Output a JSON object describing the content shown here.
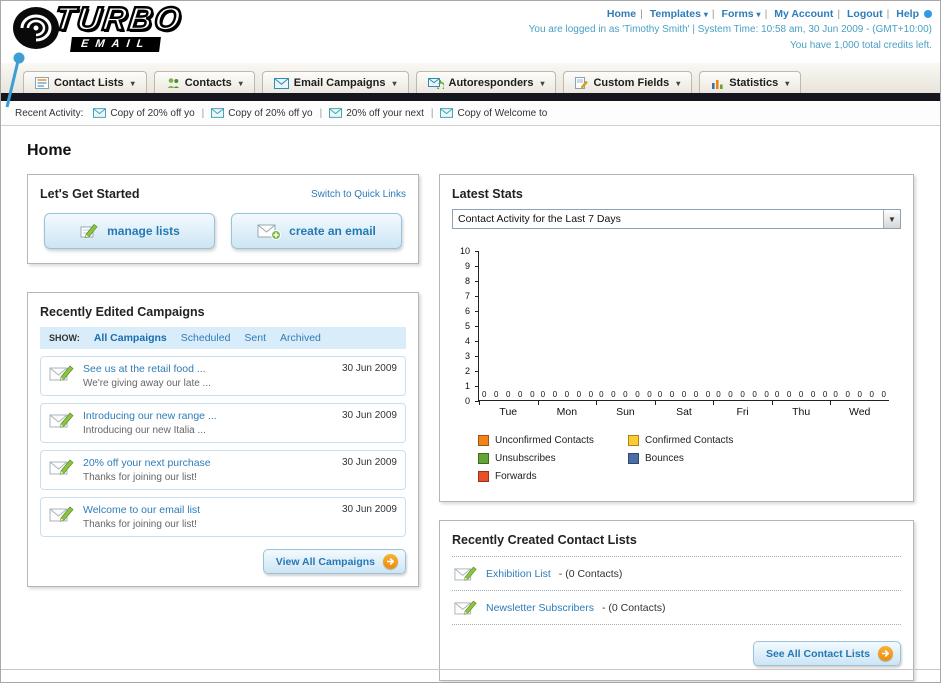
{
  "colors": {
    "link": "#2e7cb8",
    "dark_bar": "#15151d",
    "accent_orange": "#ec8c06"
  },
  "header": {
    "logo_top": "TURBO",
    "logo_bottom": "EMAIL",
    "nav": [
      {
        "label": "Home"
      },
      {
        "label": "Templates"
      },
      {
        "label": "Forms"
      },
      {
        "label": "My Account"
      },
      {
        "label": "Logout"
      },
      {
        "label": "Help"
      }
    ],
    "login_info": "You are logged in as 'Timothy Smith' | System Time: 10:58 am, 30 Jun 2009 - (GMT+10:00)",
    "credits_info": "You have 1,000 total credits left."
  },
  "nav_tabs": [
    {
      "label": "Contact Lists"
    },
    {
      "label": "Contacts"
    },
    {
      "label": "Email Campaigns"
    },
    {
      "label": "Autoresponders"
    },
    {
      "label": "Custom Fields"
    },
    {
      "label": "Statistics"
    }
  ],
  "recent_activity": {
    "label": "Recent Activity:",
    "items": [
      {
        "title": "Copy of 20% off yo"
      },
      {
        "title": "Copy of 20% off yo"
      },
      {
        "title": "20% off your next"
      },
      {
        "title": "Copy of Welcome to"
      }
    ]
  },
  "page_title": "Home",
  "get_started": {
    "title": "Let's Get Started",
    "switch_link": "Switch to Quick Links",
    "buttons": [
      {
        "label": "manage lists"
      },
      {
        "label": "create an email"
      }
    ]
  },
  "campaigns": {
    "title": "Recently Edited Campaigns",
    "show_label": "SHOW:",
    "filters": [
      "All Campaigns",
      "Scheduled",
      "Sent",
      "Archived"
    ],
    "active_filter": "All Campaigns",
    "items": [
      {
        "title": "See us at the retail food ...",
        "subtitle": "We're giving away our late ...",
        "date": "30 Jun 2009"
      },
      {
        "title": "Introducing our new range ...",
        "subtitle": "Introducing our new Italia ...",
        "date": "30 Jun 2009"
      },
      {
        "title": "20% off your next purchase",
        "subtitle": "Thanks for joining our list!",
        "date": "30 Jun 2009"
      },
      {
        "title": "Welcome to our email list",
        "subtitle": "Thanks for joining our list!",
        "date": "30 Jun 2009"
      }
    ],
    "view_all_label": "View All Campaigns"
  },
  "stats": {
    "title": "Latest Stats",
    "period_selector": "Contact Activity for the Last 7 Days",
    "chart_data": {
      "type": "bar",
      "categories": [
        "Tue",
        "Mon",
        "Sun",
        "Sat",
        "Fri",
        "Thu",
        "Wed"
      ],
      "series": [
        {
          "name": "Unconfirmed Contacts",
          "color": "#f08418",
          "values": [
            0,
            0,
            0,
            0,
            0,
            0,
            0
          ]
        },
        {
          "name": "Confirmed Contacts",
          "color": "#ffcb2e",
          "values": [
            0,
            0,
            0,
            0,
            0,
            0,
            0
          ]
        },
        {
          "name": "Unsubscribes",
          "color": "#63a434",
          "values": [
            0,
            0,
            0,
            0,
            0,
            0,
            0
          ]
        },
        {
          "name": "Bounces",
          "color": "#4a6da7",
          "values": [
            0,
            0,
            0,
            0,
            0,
            0,
            0
          ]
        },
        {
          "name": "Forwards",
          "color": "#e8502a",
          "values": [
            0,
            0,
            0,
            0,
            0,
            0,
            0
          ]
        }
      ],
      "ylim": [
        0,
        10
      ],
      "yticks": [
        0,
        1,
        2,
        3,
        4,
        5,
        6,
        7,
        8,
        9,
        10
      ],
      "grid": false,
      "legend_position": "bottom"
    }
  },
  "contact_lists": {
    "title": "Recently Created Contact Lists",
    "items": [
      {
        "name": "Exhibition List",
        "detail": "- (0 Contacts)"
      },
      {
        "name": "Newsletter Subscribers",
        "detail": "- (0 Contacts)"
      }
    ],
    "see_all_label": "See All Contact Lists"
  }
}
